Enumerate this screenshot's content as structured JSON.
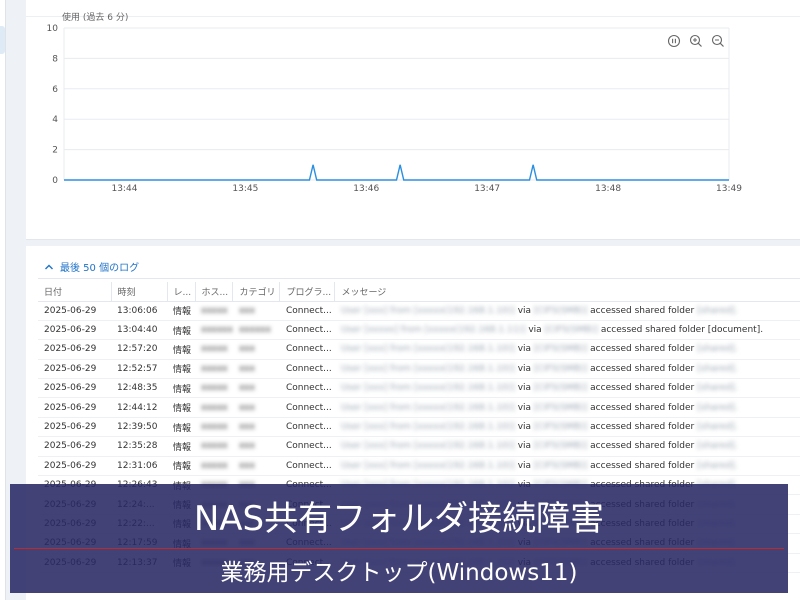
{
  "chart": {
    "toolbar_icons": [
      "pause-icon",
      "zoom-in-icon",
      "zoom-out-icon"
    ]
  },
  "chart_data": {
    "type": "line",
    "title": "使用 (過去 6 分)",
    "ylim": [
      0,
      10
    ],
    "y_ticks": [
      "0",
      "2",
      "4",
      "6",
      "8",
      "10"
    ],
    "x_ticks": [
      "13:44",
      "13:45",
      "13:46",
      "13:47",
      "13:48",
      "13:49"
    ],
    "grid": true,
    "series": [
      {
        "color": "#2b8fe0",
        "points": [
          [
            43.5,
            0
          ],
          [
            44.0,
            0
          ],
          [
            45.0,
            0
          ],
          [
            45.53,
            0
          ],
          [
            45.56,
            1
          ],
          [
            45.59,
            0
          ],
          [
            46.25,
            0
          ],
          [
            46.28,
            1
          ],
          [
            46.31,
            0
          ],
          [
            47.35,
            0
          ],
          [
            47.38,
            1
          ],
          [
            47.41,
            0
          ],
          [
            48.0,
            0
          ],
          [
            49.0,
            0
          ]
        ]
      }
    ]
  },
  "log_section": {
    "title": "最後 50 個のログ",
    "columns": [
      "日付",
      "時刻",
      "レ...",
      "ホス...",
      "カテゴリ",
      "プログラ...",
      "メッセージ"
    ],
    "rows": [
      {
        "date": "2025-06-29",
        "time": "13:06:06",
        "level": "情報",
        "host": "xxxxx",
        "category": "xxx",
        "program": "Connect...",
        "message_prefix": "User [xxx] from [xxxxx(192.168.1.10)]",
        "via": "via",
        "protocol": "[CIFS(SMB)]",
        "action": "accessed shared folder",
        "folder": "[shared]."
      },
      {
        "date": "2025-06-29",
        "time": "13:04:40",
        "level": "情報",
        "host": "xxxxxx",
        "category": "xxxxxx",
        "program": "Connect...",
        "message_prefix": "User [xxxxx] from [xxxxx(192.168.1.11)]",
        "via": "via",
        "protocol": "[CIFS(SMB)]",
        "action": "accessed shared folder",
        "folder": "[document]."
      },
      {
        "date": "2025-06-29",
        "time": "12:57:20",
        "level": "情報",
        "host": "xxxxx",
        "category": "xxx",
        "program": "Connect...",
        "message_prefix": "User [xxx] from [xxxxx(192.168.1.10)]",
        "via": "via",
        "protocol": "[CIFS(SMB)]",
        "action": "accessed shared folder",
        "folder": "[shared]."
      },
      {
        "date": "2025-06-29",
        "time": "12:52:57",
        "level": "情報",
        "host": "xxxxx",
        "category": "xxx",
        "program": "Connect...",
        "message_prefix": "User [xxx] from [xxxxx(192.168.1.10)]",
        "via": "via",
        "protocol": "[CIFS(SMB)]",
        "action": "accessed shared folder",
        "folder": "[shared]."
      },
      {
        "date": "2025-06-29",
        "time": "12:48:35",
        "level": "情報",
        "host": "xxxxx",
        "category": "xxx",
        "program": "Connect...",
        "message_prefix": "User [xxx] from [xxxxx(192.168.1.10)]",
        "via": "via",
        "protocol": "[CIFS(SMB)]",
        "action": "accessed shared folder",
        "folder": "[shared]."
      },
      {
        "date": "2025-06-29",
        "time": "12:44:12",
        "level": "情報",
        "host": "xxxxx",
        "category": "xxx",
        "program": "Connect...",
        "message_prefix": "User [xxx] from [xxxxx(192.168.1.10)]",
        "via": "via",
        "protocol": "[CIFS(SMB)]",
        "action": "accessed shared folder",
        "folder": "[shared]."
      },
      {
        "date": "2025-06-29",
        "time": "12:39:50",
        "level": "情報",
        "host": "xxxxx",
        "category": "xxx",
        "program": "Connect...",
        "message_prefix": "User [xxx] from [xxxxx(192.168.1.10)]",
        "via": "via",
        "protocol": "[CIFS(SMB)]",
        "action": "accessed shared folder",
        "folder": "[shared]."
      },
      {
        "date": "2025-06-29",
        "time": "12:35:28",
        "level": "情報",
        "host": "xxxxx",
        "category": "xxx",
        "program": "Connect...",
        "message_prefix": "User [xxx] from [xxxxx(192.168.1.10)]",
        "via": "via",
        "protocol": "[CIFS(SMB)]",
        "action": "accessed shared folder",
        "folder": "[shared]."
      },
      {
        "date": "2025-06-29",
        "time": "12:31:06",
        "level": "情報",
        "host": "xxxxx",
        "category": "xxx",
        "program": "Connect...",
        "message_prefix": "User [xxx] from [xxxxx(192.168.1.10)]",
        "via": "via",
        "protocol": "[CIFS(SMB)]",
        "action": "accessed shared folder",
        "folder": "[shared]."
      },
      {
        "date": "2025-06-29",
        "time": "12:26:43",
        "level": "情報",
        "host": "xxxxx",
        "category": "xxx",
        "program": "Connect...",
        "message_prefix": "User [xxx] from [xxxxx(192.168.1.10)]",
        "via": "via",
        "protocol": "[CIFS(SMB)]",
        "action": "accessed shared folder",
        "folder": "[shared]."
      },
      {
        "date": "2025-06-29",
        "time": "12:24:...",
        "level": "情報",
        "host": "xxxxx",
        "category": "xxx",
        "program": "Connect...",
        "message_prefix": "User [xxx] from [xxxxx(192.168.1.10)]",
        "via": "via",
        "protocol": "[CIFS(SMB)]",
        "action": "accessed shared folder",
        "folder": "[shared]."
      },
      {
        "date": "2025-06-29",
        "time": "12:22:...",
        "level": "情報",
        "host": "xxxxx",
        "category": "xxx",
        "program": "Connect...",
        "message_prefix": "User [xxx] from [xxxxx(192.168.1.10)]",
        "via": "via",
        "protocol": "[CIFS(SMB)]",
        "action": "accessed shared folder",
        "folder": "[shared]."
      },
      {
        "date": "2025-06-29",
        "time": "12:17:59",
        "level": "情報",
        "host": "xxxxx",
        "category": "xxx",
        "program": "Connect...",
        "message_prefix": "User [xxx] from [xxxxx(192.168.1.10)]",
        "via": "via",
        "protocol": "[CIFS(SMB)]",
        "action": "accessed shared folder",
        "folder": "[shared]."
      },
      {
        "date": "2025-06-29",
        "time": "12:13:37",
        "level": "情報",
        "host": "xxxxx",
        "category": "xxx",
        "program": "Connect...",
        "message_prefix": "User [xxx] from [xxxxx(192.168.1.10)]",
        "via": "via",
        "protocol": "[CIFS(SMB)]",
        "action": "accessed shared folder",
        "folder": "[shared]."
      }
    ]
  },
  "overlay": {
    "title": "NAS共有フォルダ接続障害",
    "subtitle": "業務用デスクトップ(Windows11)",
    "rule_color": "#c0282a"
  }
}
